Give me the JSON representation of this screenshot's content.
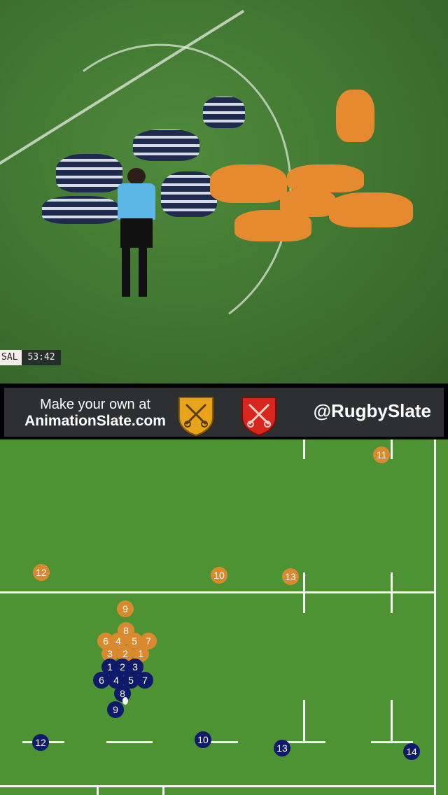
{
  "video": {
    "scorebug": {
      "team": "SAL",
      "clock": "53:42"
    }
  },
  "banner": {
    "promo_line1": "Make your own at",
    "promo_line2": "AnimationSlate.com",
    "handle": "@RugbySlate",
    "crests": [
      {
        "name": "gold-crest-icon",
        "color": "#e8a51c"
      },
      {
        "name": "red-crest-icon",
        "color": "#d8261f"
      }
    ]
  },
  "board": {
    "colors": {
      "pitch": "#4d9233",
      "orange": "#d98a2f",
      "navy": "#0f1a6b",
      "lines": "#f4f4f4"
    },
    "orange_players": {
      "fly_half": "10",
      "winger_11": "11",
      "winger_12": "12",
      "centre_13": "13",
      "scrum_half": "9",
      "pack": [
        "8",
        "6",
        "4",
        "5",
        "7",
        "3",
        "2",
        "1"
      ]
    },
    "navy_players": {
      "pack": [
        "1",
        "2",
        "3",
        "6",
        "4",
        "5",
        "7",
        "8"
      ],
      "scrum_half": "9",
      "winger_12": "12",
      "fly_half": "10",
      "centre_13": "13",
      "winger_14": "14"
    }
  }
}
